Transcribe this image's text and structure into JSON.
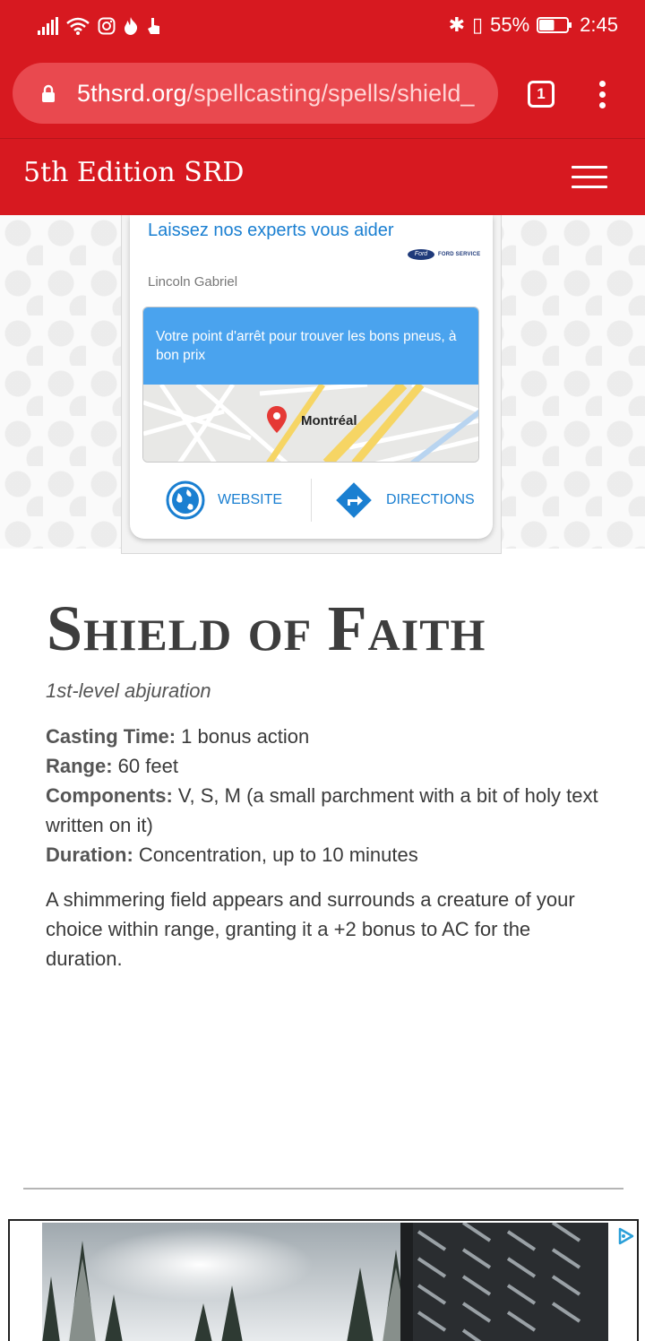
{
  "status_bar": {
    "bluetooth": "✱",
    "vibrate": "▯",
    "battery_percent": "55%",
    "battery_level": 0.55,
    "time": "2:45"
  },
  "browser": {
    "url_domain": "5thsrd.org",
    "url_path": "/spellcasting/spells/shield_",
    "tab_count": "1"
  },
  "site": {
    "title": "5th Edition SRD"
  },
  "ad": {
    "headline": "Laissez nos experts vous aider",
    "advertiser": "Lincoln Gabriel",
    "brand_logo_text": "Ford",
    "brand_service_text": "FORD SERVICE",
    "banner_text": "Votre point d'arrêt pour trouver les bons pneus, à bon prix",
    "map_label": "Montréal",
    "website_label": "WEBSITE",
    "directions_label": "DIRECTIONS",
    "colors": {
      "link": "#1a7fd1",
      "banner": "#4aa3ee",
      "pin": "#e53935"
    }
  },
  "spell": {
    "title_words": [
      {
        "cap": "S",
        "rest": "HIELD"
      },
      {
        "cap": "",
        "rest": "OF"
      },
      {
        "cap": "F",
        "rest": "AITH"
      }
    ],
    "type": "1st-level abjuration",
    "properties": [
      {
        "label": "Casting Time:",
        "value": " 1 bonus action"
      },
      {
        "label": "Range:",
        "value": " 60 feet"
      },
      {
        "label": "Components:",
        "value": " V, S, M (a small parchment with a bit of holy text written on it)"
      },
      {
        "label": "Duration:",
        "value": " Concentration, up to 10 minutes"
      }
    ],
    "description": "A shimmering field appears and surrounds a creature of your choice within range, granting it a +2 bonus to AC for the duration."
  },
  "theme": {
    "brand_red": "#d71920",
    "url_pill": "#e9494f",
    "text": "#3a3a3a"
  }
}
